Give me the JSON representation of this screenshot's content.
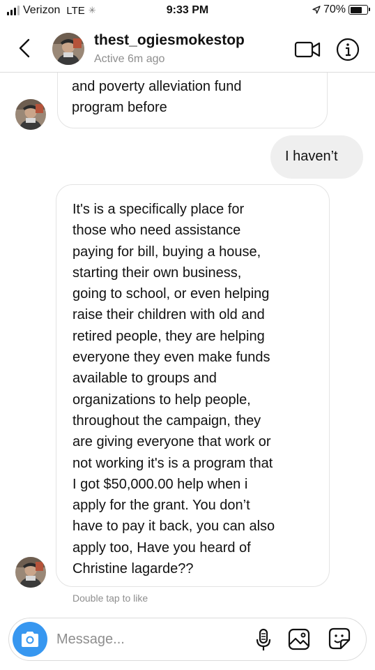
{
  "status_bar": {
    "carrier": "Verizon",
    "network": "LTE",
    "time": "9:33 PM",
    "battery": "70%",
    "battery_level": 0.7
  },
  "header": {
    "username": "thest_ogiesmokestop",
    "active_status": "Active 6m ago"
  },
  "messages": [
    {
      "from": "them",
      "lines": [
        "and poverty alleviation fund",
        "program before"
      ]
    },
    {
      "from": "me",
      "text": "I haven’t"
    },
    {
      "from": "them",
      "lines": [
        "It's is a specifically place for",
        "those who need assistance",
        "paying for bill, buying a house,",
        "starting their own business,",
        "going to school, or even helping",
        "raise their children with old and",
        "retired people, they are helping",
        "everyone they even make funds",
        "available to groups and",
        "organizations to help people,",
        "throughout the campaign, they",
        "are giving everyone that work or",
        "not working it's is a program that",
        "I got $50,000.00 help when i",
        "apply for the grant. You don’t",
        "have to pay it back, you can also",
        "apply too, Have you heard of",
        "Christine lagarde??"
      ]
    }
  ],
  "hint": "Double tap to like",
  "composer": {
    "placeholder": "Message..."
  },
  "icons": [
    "signal-icon",
    "activity-spinner-icon",
    "location-arrow-icon",
    "battery-icon",
    "back-chevron-icon",
    "video-call-icon",
    "info-icon",
    "camera-icon",
    "microphone-icon",
    "gallery-icon",
    "sticker-icon"
  ],
  "colors": {
    "accent": "#3797f0",
    "outgoing_bubble": "#efefef",
    "secondary_text": "#8e8e8e",
    "border": "#dbdbdb"
  }
}
